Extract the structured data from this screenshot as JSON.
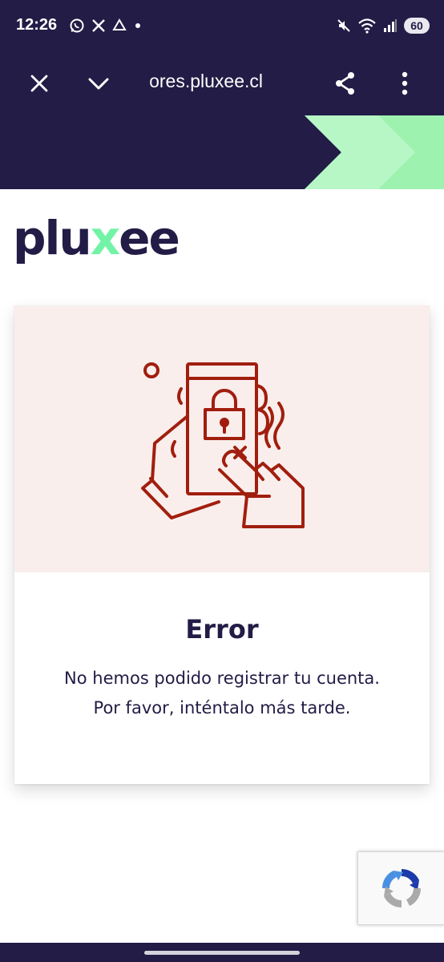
{
  "status_bar": {
    "time": "12:26",
    "left_icons": [
      "whatsapp-icon",
      "x-icon",
      "drive-icon",
      "dot-icon"
    ],
    "right_icons": [
      "mute-icon",
      "wifi-icon",
      "signal-icon"
    ],
    "battery": "60"
  },
  "browser": {
    "url": "ores.pluxee.cl",
    "close_icon": "close-icon",
    "collapse_icon": "chevron-down-icon",
    "share_icon": "share-icon",
    "menu_icon": "more-vert-icon"
  },
  "logo": {
    "prefix": "plu",
    "x": "x",
    "suffix": "ee"
  },
  "error_card": {
    "title": "Error",
    "message_line1": "No hemos podido registrar tu cuenta.",
    "message_line2": "Por favor, inténtalo más tarde.",
    "illustration": "phone-lock-error-icon"
  },
  "recaptcha": {
    "icon": "recaptcha-icon"
  },
  "colors": {
    "brand_dark": "#221c46",
    "brand_green": "#b7f7c6",
    "brand_green_bright": "#9ef2b0",
    "illus_bg": "#f9eeec",
    "illus_red": "#a11e0e"
  }
}
